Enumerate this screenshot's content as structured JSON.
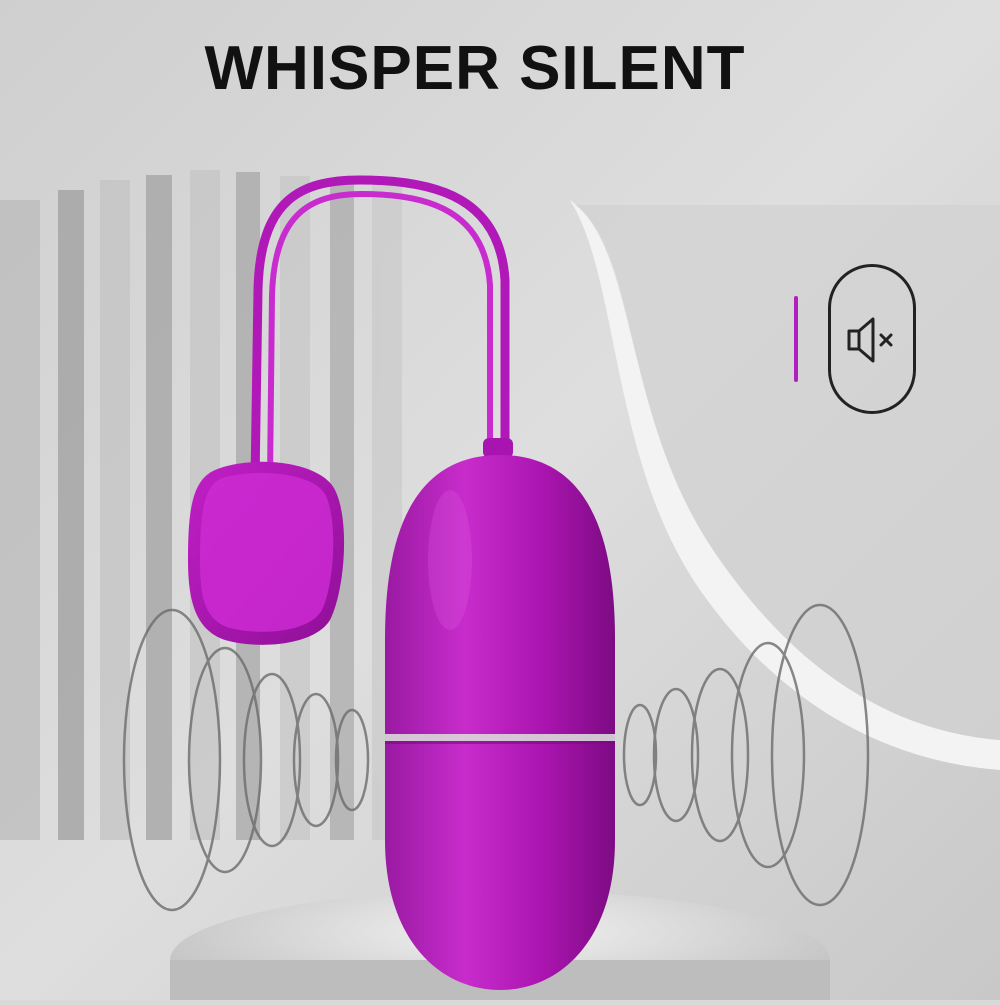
{
  "headline": "WHISPER SILENT",
  "icons": {
    "mute": "speaker-muted-icon"
  },
  "colors": {
    "product": "#c21ec6",
    "product_shadow": "#8a0f90",
    "background": "#d9d9d9",
    "accent": "#b020c0",
    "headline": "#111111"
  }
}
